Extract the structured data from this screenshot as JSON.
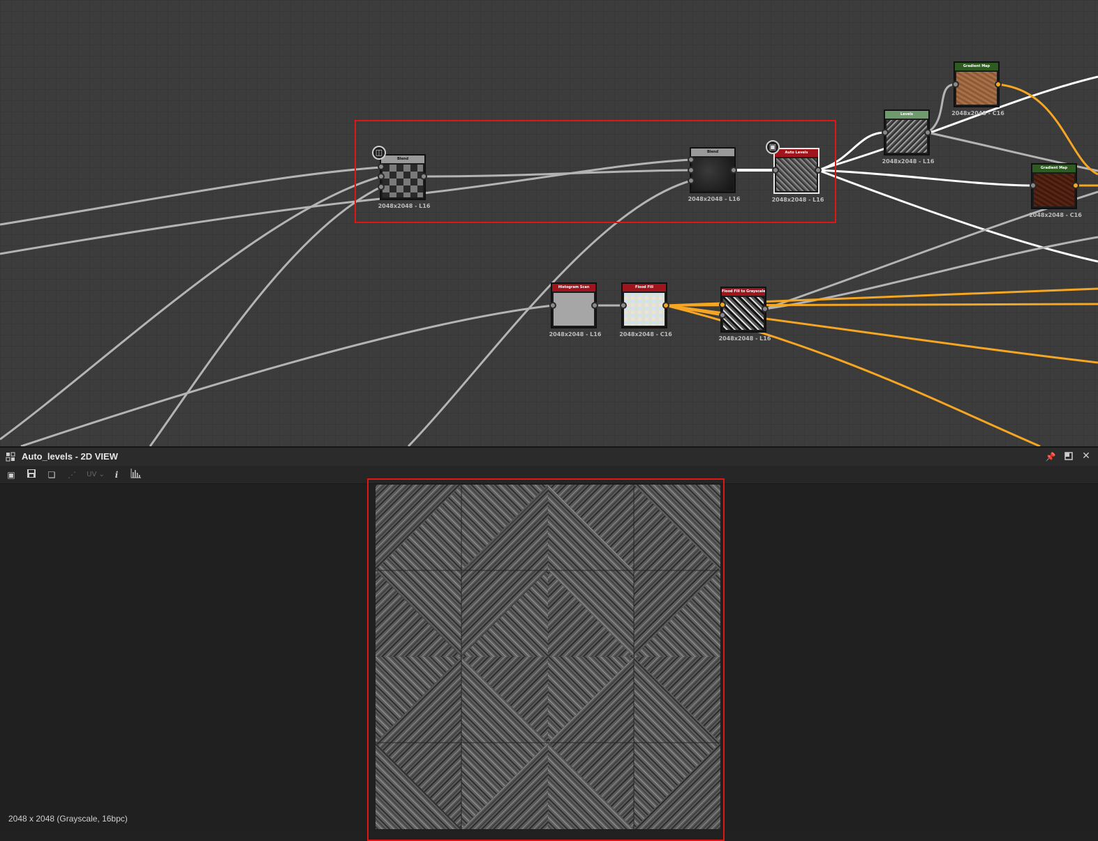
{
  "graph": {
    "nodes": [
      {
        "id": "blend1",
        "title": "Blend",
        "resolution": "2048x2048 - L16",
        "header_color": "#9a9a9a",
        "thumb": "checker"
      },
      {
        "id": "blend2",
        "title": "Blend",
        "resolution": "2048x2048 - L16",
        "header_color": "#9a9a9a",
        "thumb": "dark"
      },
      {
        "id": "autolevels",
        "title": "Auto Levels",
        "resolution": "2048x2048 - L16",
        "header_color": "#a0141c",
        "thumb": "wood"
      },
      {
        "id": "levels",
        "title": "Levels",
        "resolution": "2048x2048 - L16",
        "header_color": "#6e9a6e",
        "thumb": "wood"
      },
      {
        "id": "gradmap1",
        "title": "Gradient Map",
        "resolution": "2048x2048 - C16",
        "header_color": "#2f5a22",
        "thumb": "brown-light"
      },
      {
        "id": "gradmap2",
        "title": "Gradient Map",
        "resolution": "2048x2048 - C16",
        "header_color": "#2f5a22",
        "thumb": "brown-dark"
      },
      {
        "id": "histscan",
        "title": "Histogram Scan",
        "resolution": "2048x2048 - L16",
        "header_color": "#a0141c",
        "thumb": "gray"
      },
      {
        "id": "floodfill",
        "title": "Flood Fill",
        "resolution": "2048x2048 - C16",
        "header_color": "#a0141c",
        "thumb": "pastel"
      },
      {
        "id": "ff2gray",
        "title": "Flood Fill to Grayscale",
        "resolution": "2048x2048 - L16",
        "header_color": "#a0141c",
        "thumb": "diamond"
      }
    ],
    "badge_icons": {
      "blend1": "document-icon",
      "autolevels": "checker-icon"
    },
    "colors": {
      "wire_gray": "#b4b4b4",
      "wire_white": "#ffffff",
      "wire_orange": "#f5a623",
      "highlight": "#e01515"
    }
  },
  "panel": {
    "title": "Auto_levels - 2D VIEW",
    "toolbar": {
      "uv_label": "UV"
    },
    "status": "2048 x 2048 (Grayscale, 16bpc)"
  }
}
